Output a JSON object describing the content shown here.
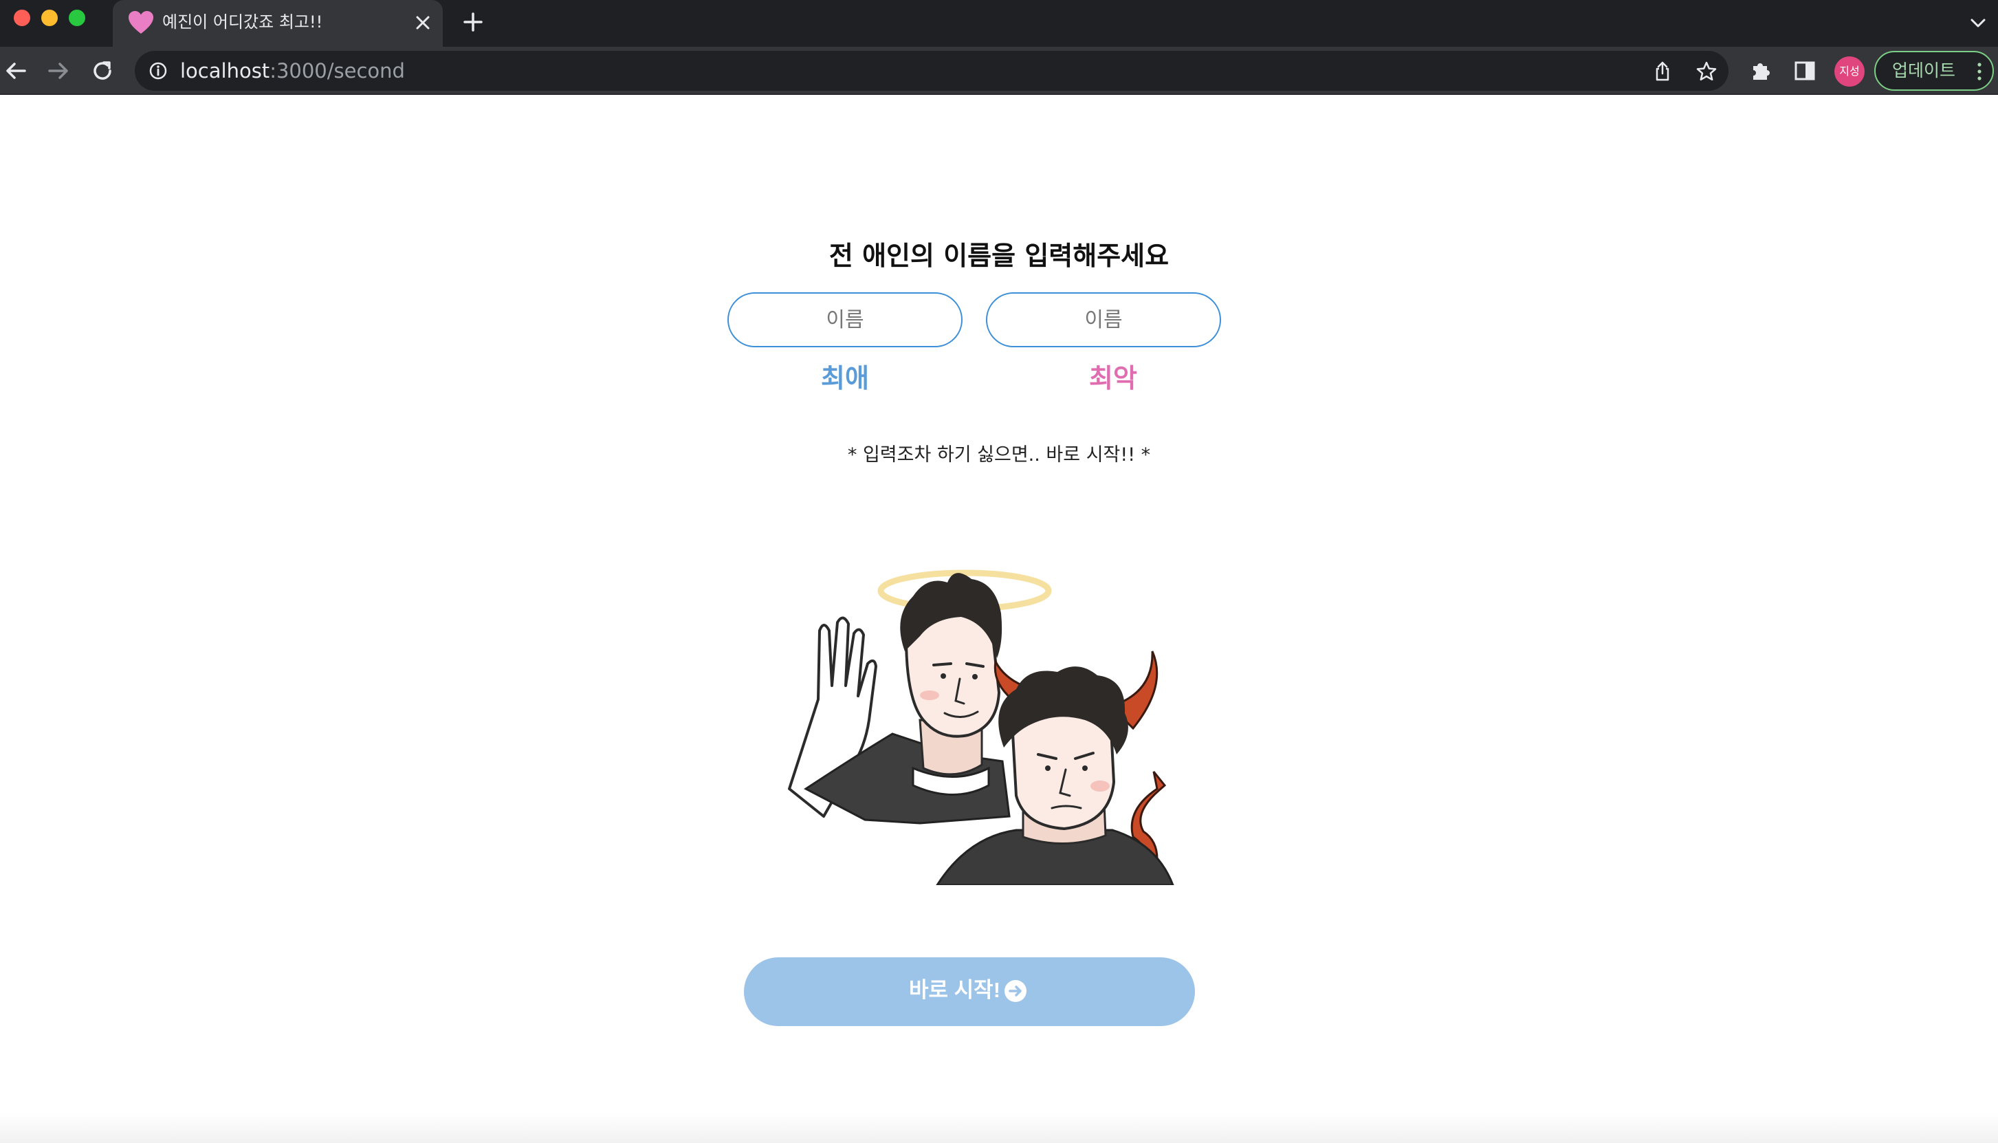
{
  "browser": {
    "tab_title": "예진이 어디갔죠 최고!!",
    "url_host": "localhost",
    "url_path": ":3000/second",
    "profile_initials": "지성",
    "update_label": "업데이트"
  },
  "page": {
    "headline": "전 애인의 이름을 입력해주세요",
    "inputs": [
      {
        "placeholder": "이름",
        "value": ""
      },
      {
        "placeholder": "이름",
        "value": ""
      }
    ],
    "labels": {
      "best": "최애",
      "worst": "최악"
    },
    "hint": "* 입력조차 하기 싫으면.. 바로 시작!! *",
    "illustration_icon": "angel-devil-illustration",
    "start_button": "바로 시작!",
    "start_button_icon": "arrow-right-circle-icon"
  },
  "colors": {
    "input_border": "#3d8fd8",
    "best_label": "#5a9bd8",
    "worst_label": "#e06db0",
    "start_button_bg": "#9cc3e8",
    "favicon_heart": "#e97ec4"
  }
}
